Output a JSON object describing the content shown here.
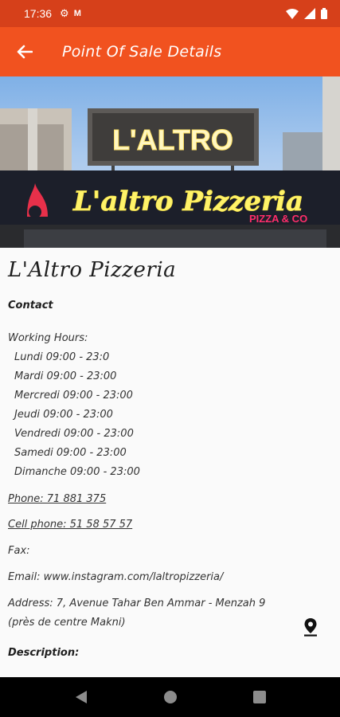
{
  "status_bar": {
    "time": "17:36",
    "icons": [
      "gear-icon",
      "gmail-icon",
      "wifi-icon",
      "signal-icon",
      "battery-icon"
    ]
  },
  "app_bar": {
    "back_icon": "arrow-left-icon",
    "title": "Point Of Sale Details"
  },
  "hero": {
    "sign_top": "L'ALTRO",
    "sign_main": "L'altro Pizzeria",
    "sign_sub": "PIZZA & CO"
  },
  "details": {
    "name": "L'Altro Pizzeria",
    "contact_label": "Contact",
    "working_hours_label": "Working Hours:",
    "hours": [
      "Lundi 09:00 - 23:0",
      "Mardi 09:00 - 23:00",
      "Mercredi 09:00 - 23:00",
      "Jeudi 09:00 - 23:00",
      "Vendredi 09:00 - 23:00",
      "Samedi 09:00 - 23:00",
      "Dimanche 09:00 - 23:00"
    ],
    "phone": "Phone: 71 881 375",
    "cell_phone": "Cell phone: 51 58 57 57",
    "fax": "Fax:",
    "email": "Email: www.instagram.com/laltropizzeria/",
    "address_line1": "Address: 7, Avenue Tahar Ben Ammar - Menzah 9",
    "address_line2": "(près de centre Makni)",
    "description_label": "Description:",
    "map_icon": "location-pin-icon"
  },
  "colors": {
    "status_bar": "#d6401a",
    "app_bar": "#f1521f",
    "nav_bar": "#000000"
  },
  "nav_bar": {
    "icons": [
      "back-triangle-icon",
      "home-circle-icon",
      "recents-square-icon"
    ]
  }
}
